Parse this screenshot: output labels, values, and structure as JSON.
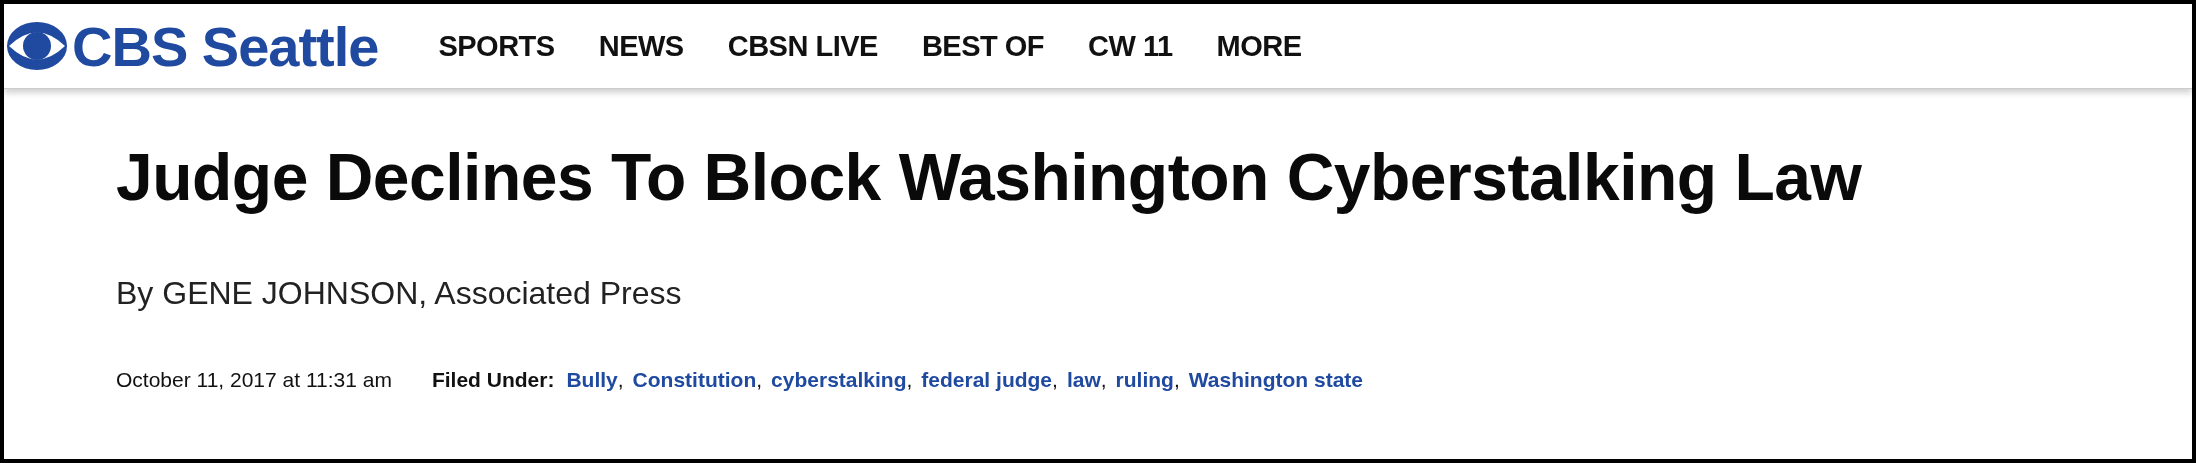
{
  "header": {
    "logo_text": "CBS Seattle",
    "nav": [
      {
        "label": "SPORTS"
      },
      {
        "label": "NEWS"
      },
      {
        "label": "CBSN LIVE"
      },
      {
        "label": "BEST OF"
      },
      {
        "label": "CW 11"
      },
      {
        "label": "MORE"
      }
    ]
  },
  "article": {
    "title": "Judge Declines To Block Washington Cyberstalking Law",
    "byline": "By GENE JOHNSON, Associated Press",
    "date": "October 11, 2017 at 11:31 am",
    "filed_label": "Filed Under:",
    "tag_separator": ",",
    "tags": [
      "Bully",
      "Constitution",
      "cyberstalking",
      "federal judge",
      "law",
      "ruling",
      "Washington state"
    ]
  }
}
